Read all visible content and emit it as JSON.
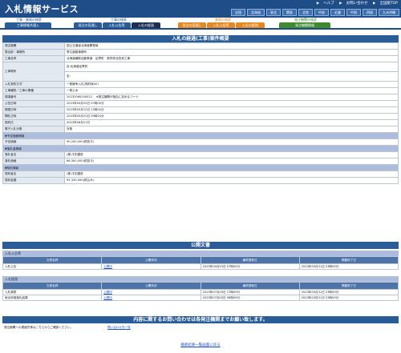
{
  "header": {
    "title": "入札情報サービス",
    "util_links": [
      "ヘルプ",
      "お問い合わせ",
      "全国版TOP"
    ],
    "regions": [
      "全国",
      "北海道",
      "東北",
      "関東",
      "北陸",
      "中部",
      "近畿",
      "中国",
      "四国",
      "九州沖縄"
    ]
  },
  "nav": {
    "group1": {
      "label": "工事・業務の検索",
      "tabs": [
        "工事情報共通入"
      ]
    },
    "group2": {
      "label": "工事の検索",
      "tabs": [
        "発注の見通し",
        "入札公告等",
        "入札の経過"
      ]
    },
    "group3": {
      "label": "業務の検索",
      "tabs": [
        "発注の見通し",
        "入札公告等",
        "入札の経過"
      ]
    },
    "group4": {
      "label": "発注機関の検索",
      "tabs": [
        "発注機関情報"
      ]
    }
  },
  "detail": {
    "heading": "入札の経過(工事)案件概要",
    "rows": [
      {
        "label": "発注機関",
        "value": "国土交通省北海道開発局"
      },
      {
        "label": "提出部・事務所",
        "value": "帯広道路事務所"
      },
      {
        "label": "工事名称",
        "value": "北海道横断自動車道　足寄町　勲祢別北改良工事"
      },
      {
        "label": "工事場所",
        "value": "自:北海道足寄町"
      },
      {
        "label": "入札契約方式",
        "value": "一般競争入札(契約後VE)"
      },
      {
        "label": "工事種別／工事の業種",
        "value": "一般土木"
      },
      {
        "label": "調達番号",
        "value": "20232060200022",
        "note": "※発注機関が独自に定めるコード"
      },
      {
        "label": "公告日時",
        "value": "2023年04月25日 07時00分"
      },
      {
        "label": "期限日時",
        "value": "2023年05月12日 12時00分"
      },
      {
        "label": "開札日時",
        "value": "2023年05月25日 09時20分"
      },
      {
        "label": "契約日",
        "value": "2023年06月21日"
      },
      {
        "label": "電子入札対象",
        "value": "対象"
      }
    ],
    "extra_row": "至:",
    "yosan_head": "▼予定価格情報",
    "yosan_label": "予定価格",
    "yosan_value": "90,200,000(税抜き)",
    "rakusatsu_head": "▼落札者情報",
    "rakusatsu_name_label": "落札者名",
    "rakusatsu_name": "(株)平田建設",
    "rakusatsu_price_label": "落札価格",
    "rakusatsu_price": "86,300,000(税抜き)",
    "keiyaku_head": "▼契約情報",
    "keiyaku_name_label": "契約者名",
    "keiyaku_name": "(株)平田建設",
    "keiyaku_price_label": "契約金額",
    "keiyaku_price": "95,330,000(税込み)"
  },
  "docs": {
    "heading": "公開文書",
    "cols": [
      "文書名称",
      "公開状況",
      "最終更新日",
      "掲載終了日"
    ],
    "groups": [
      {
        "title": "入札公告等",
        "rows": [
          {
            "name": "入札公告",
            "status": "公開中",
            "updated": "2023年04月25日 07時00分",
            "end": "2023年03月31日 23時59分"
          }
        ]
      },
      {
        "title": "入札経過",
        "rows": [
          {
            "name": "入札調書",
            "status": "公開中",
            "updated": "2023年07月04日 17時09分",
            "end": "2023年03月31日 23時59分"
          },
          {
            "name": "総合評価落札結果",
            "status": "公開中",
            "updated": "2023年07月05日 06時09分",
            "end": "2023年03月31日 23時59分"
          }
        ]
      }
    ]
  },
  "contact": {
    "heading": "内容に関するお問い合わせは各発注機関までお願い致します。",
    "text": "発注機関への連絡先等はこちらからご確認ください。",
    "link": "問い合わせ先一覧"
  },
  "back_link": "検索結果一覧画面に戻る",
  "colors": {
    "header": "#1f4d87",
    "tab_blue": "#2a5c97",
    "tab_orange": "#e6871f",
    "tab_green": "#3f8a2c",
    "tab_active": "#1c2f52"
  }
}
